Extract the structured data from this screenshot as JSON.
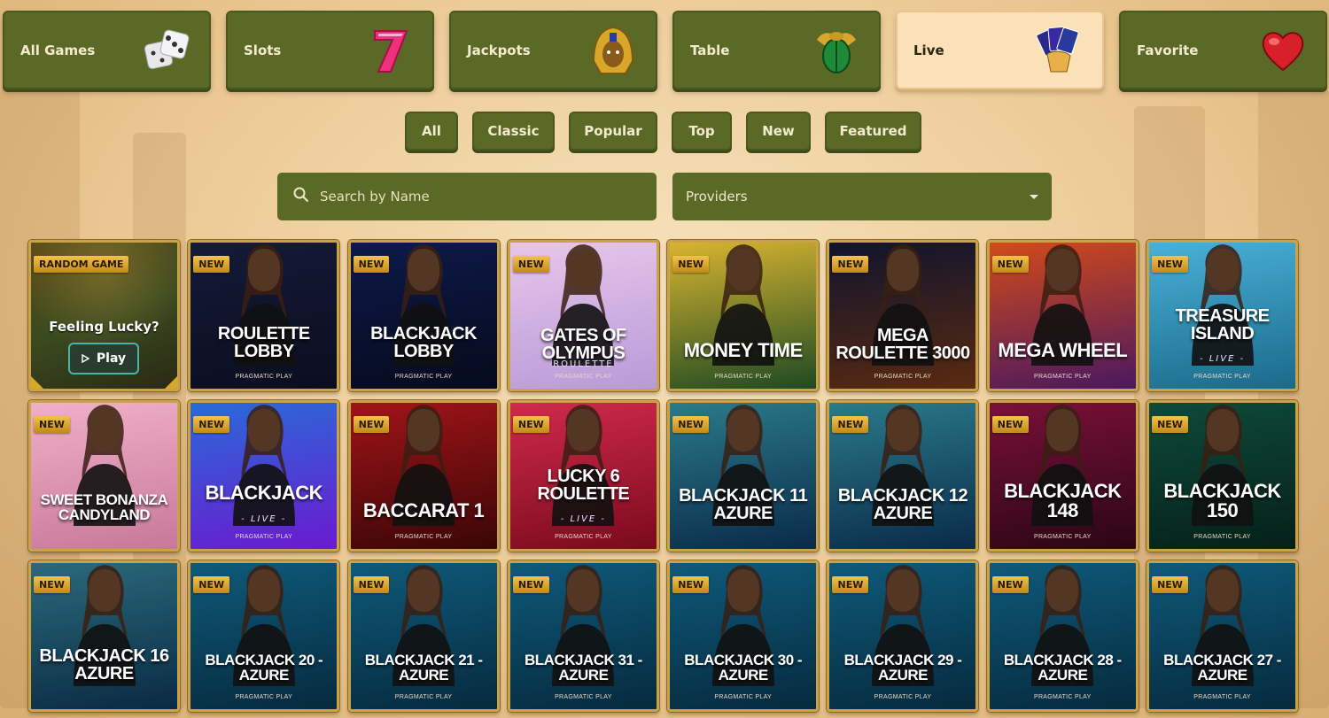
{
  "categories": [
    {
      "label": "All Games",
      "icon": "dice-icon",
      "active": false
    },
    {
      "label": "Slots",
      "icon": "seven-icon",
      "active": false
    },
    {
      "label": "Jackpots",
      "icon": "pharaoh-icon",
      "active": false
    },
    {
      "label": "Table",
      "icon": "scarab-icon",
      "active": false
    },
    {
      "label": "Live",
      "icon": "cards-hand-icon",
      "active": true
    },
    {
      "label": "Favorite",
      "icon": "heart-icon",
      "active": false
    }
  ],
  "filters": [
    "All",
    "Classic",
    "Popular",
    "Top",
    "New",
    "Featured"
  ],
  "search": {
    "placeholder": "Search by Name"
  },
  "providers": {
    "label": "Providers"
  },
  "random": {
    "badge": "RANDOM GAME",
    "text": "Feeling Lucky?",
    "button": "Play"
  },
  "badge_new": "NEW",
  "games": [
    {
      "title": "ROULETTE LOBBY",
      "provider": "PRAGMATIC PLAY",
      "live": "",
      "bg": [
        "#141a38",
        "#0b0e1f"
      ]
    },
    {
      "title": "BLACKJACK LOBBY",
      "provider": "PRAGMATIC PLAY",
      "live": "",
      "bg": [
        "#0d1a4a",
        "#060a1c"
      ]
    },
    {
      "title": "GATES OF OLYMPUS",
      "sub": "ROULETTE",
      "provider": "PRAGMATIC PLAY",
      "live": "",
      "bg": [
        "#e8c6ea",
        "#b89ad8"
      ]
    },
    {
      "title": "MONEY TIME",
      "provider": "PRAGMATIC PLAY",
      "live": "",
      "bg": [
        "#d8b430",
        "#1e4a22"
      ]
    },
    {
      "title": "MEGA ROULETTE 3000",
      "provider": "PRAGMATIC PLAY",
      "live": "",
      "bg": [
        "#10142e",
        "#5a2a10"
      ]
    },
    {
      "title": "MEGA WHEEL",
      "provider": "PRAGMATIC PLAY",
      "live": "",
      "bg": [
        "#d24a1a",
        "#4a1860"
      ]
    },
    {
      "title": "TREASURE ISLAND",
      "provider": "PRAGMATIC PLAY",
      "live": "- LIVE -",
      "bg": [
        "#4ab0d8",
        "#1a6a8a"
      ]
    },
    {
      "title": "SWEET BONANZA CANDYLAND",
      "provider": "",
      "live": "",
      "bg": [
        "#f0b0c8",
        "#c8789a"
      ]
    },
    {
      "title": "BLACKJACK",
      "provider": "PRAGMATIC PLAY",
      "live": "- LIVE -",
      "bg": [
        "#2a6ad8",
        "#6a1ad0"
      ]
    },
    {
      "title": "BACCARAT 1",
      "provider": "PRAGMATIC PLAY",
      "live": "",
      "bg": [
        "#a01418",
        "#3a0606"
      ]
    },
    {
      "title": "LUCKY 6 ROULETTE",
      "provider": "PRAGMATIC PLAY",
      "live": "- LIVE -",
      "bg": [
        "#d02a4a",
        "#7a0a1e"
      ]
    },
    {
      "title": "BLACKJACK 11 AZURE",
      "provider": "",
      "live": "",
      "bg": [
        "#2a7a8a",
        "#0a2a4a"
      ]
    },
    {
      "title": "BLACKJACK 12 AZURE",
      "provider": "",
      "live": "",
      "bg": [
        "#2a7a8a",
        "#0a2a4a"
      ]
    },
    {
      "title": "BLACKJACK 148",
      "provider": "PRAGMATIC PLAY",
      "live": "",
      "bg": [
        "#7a1038",
        "#2a0614"
      ]
    },
    {
      "title": "BLACKJACK 150",
      "provider": "PRAGMATIC PLAY",
      "live": "",
      "bg": [
        "#0e4a3a",
        "#052018"
      ]
    },
    {
      "title": "BLACKJACK 16 AZURE",
      "provider": "",
      "live": "",
      "bg": [
        "#2a6a7a",
        "#0a2a44"
      ]
    },
    {
      "title": "BLACKJACK 20 - AZURE",
      "provider": "PRAGMATIC PLAY",
      "live": "",
      "bg": [
        "#0e5a7a",
        "#062a3e"
      ]
    },
    {
      "title": "BLACKJACK 21 - AZURE",
      "provider": "PRAGMATIC PLAY",
      "live": "",
      "bg": [
        "#0e5a7a",
        "#062a3e"
      ]
    },
    {
      "title": "BLACKJACK 31 - AZURE",
      "provider": "PRAGMATIC PLAY",
      "live": "",
      "bg": [
        "#0e5a7a",
        "#062a3e"
      ]
    },
    {
      "title": "BLACKJACK 30 - AZURE",
      "provider": "PRAGMATIC PLAY",
      "live": "",
      "bg": [
        "#0e5a7a",
        "#062a3e"
      ]
    },
    {
      "title": "BLACKJACK 29 - AZURE",
      "provider": "PRAGMATIC PLAY",
      "live": "",
      "bg": [
        "#0e5a7a",
        "#062a3e"
      ]
    },
    {
      "title": "BLACKJACK 28 - AZURE",
      "provider": "PRAGMATIC PLAY",
      "live": "",
      "bg": [
        "#0e5a7a",
        "#062a3e"
      ]
    },
    {
      "title": "BLACKJACK 27 - AZURE",
      "provider": "PRAGMATIC PLAY",
      "live": "",
      "bg": [
        "#0e5a7a",
        "#062a3e"
      ]
    }
  ]
}
